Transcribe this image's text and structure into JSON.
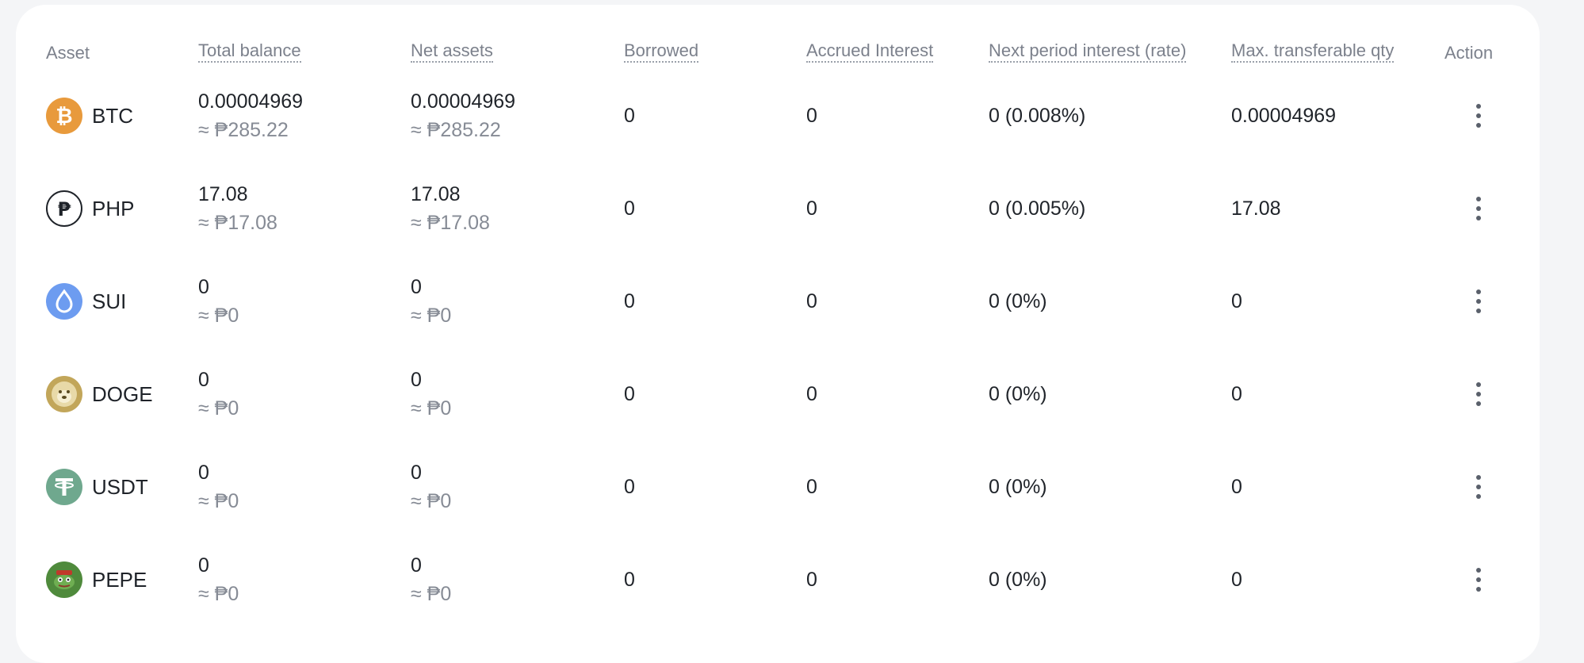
{
  "columns": {
    "asset": "Asset",
    "total_balance": "Total balance",
    "net_assets": "Net assets",
    "borrowed": "Borrowed",
    "accrued_interest": "Accrued Interest",
    "next_period_interest": "Next period interest (rate)",
    "max_transferable": "Max. transferable qty",
    "action": "Action"
  },
  "rows": [
    {
      "symbol": "BTC",
      "icon": "bitcoin-icon",
      "icon_color": "#e89a3c",
      "total_balance": "0.00004969",
      "total_balance_fiat": "≈ ₱285.22",
      "net_assets": "0.00004969",
      "net_assets_fiat": "≈ ₱285.22",
      "borrowed": "0",
      "accrued_interest": "0",
      "next_period_interest": "0 (0.008%)",
      "max_transferable": "0.00004969"
    },
    {
      "symbol": "PHP",
      "icon": "peso-icon",
      "icon_color": "#1f2329",
      "total_balance": "17.08",
      "total_balance_fiat": "≈ ₱17.08",
      "net_assets": "17.08",
      "net_assets_fiat": "≈ ₱17.08",
      "borrowed": "0",
      "accrued_interest": "0",
      "next_period_interest": "0 (0.005%)",
      "max_transferable": "17.08"
    },
    {
      "symbol": "SUI",
      "icon": "sui-droplet-icon",
      "icon_color": "#6d9cf0",
      "total_balance": "0",
      "total_balance_fiat": "≈ ₱0",
      "net_assets": "0",
      "net_assets_fiat": "≈ ₱0",
      "borrowed": "0",
      "accrued_interest": "0",
      "next_period_interest": "0 (0%)",
      "max_transferable": "0"
    },
    {
      "symbol": "DOGE",
      "icon": "doge-icon",
      "icon_color": "#c2a65a",
      "total_balance": "0",
      "total_balance_fiat": "≈ ₱0",
      "net_assets": "0",
      "net_assets_fiat": "≈ ₱0",
      "borrowed": "0",
      "accrued_interest": "0",
      "next_period_interest": "0 (0%)",
      "max_transferable": "0"
    },
    {
      "symbol": "USDT",
      "icon": "tether-icon",
      "icon_color": "#6fa88e",
      "total_balance": "0",
      "total_balance_fiat": "≈ ₱0",
      "net_assets": "0",
      "net_assets_fiat": "≈ ₱0",
      "borrowed": "0",
      "accrued_interest": "0",
      "next_period_interest": "0 (0%)",
      "max_transferable": "0"
    },
    {
      "symbol": "PEPE",
      "icon": "pepe-icon",
      "icon_color": "#4f8a3c",
      "total_balance": "0",
      "total_balance_fiat": "≈ ₱0",
      "net_assets": "0",
      "net_assets_fiat": "≈ ₱0",
      "borrowed": "0",
      "accrued_interest": "0",
      "next_period_interest": "0 (0%)",
      "max_transferable": "0"
    }
  ]
}
